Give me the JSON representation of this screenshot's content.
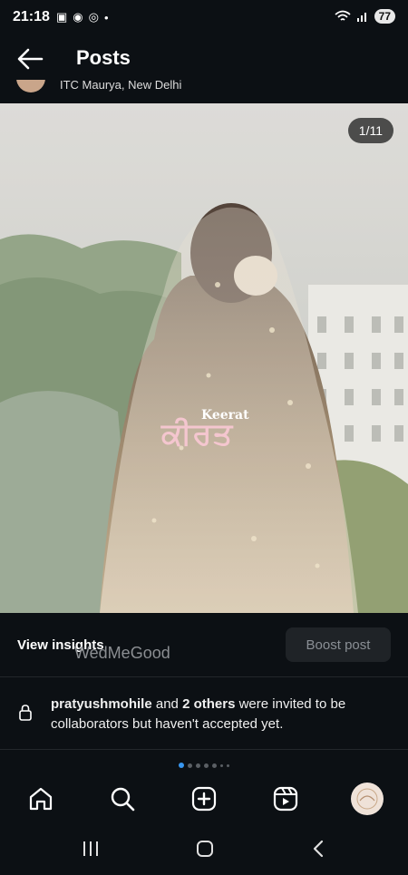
{
  "status": {
    "time": "21:18",
    "battery": "77"
  },
  "header": {
    "title": "Posts"
  },
  "post": {
    "location": "ITC Maurya, New Delhi",
    "counter": "1/11",
    "overlay_en": "Keerat",
    "overlay_pa": "ਕੀਰਤ"
  },
  "insights": {
    "view_label": "View insights",
    "watermark": "WedMeGood",
    "boost_label": "Boost post"
  },
  "collab": {
    "user": "pratyushmohile",
    "connector": " and ",
    "others": "2 others",
    "rest": " were invited to be collaborators but haven't accepted yet."
  },
  "colors": {
    "background": "#0c1014",
    "accent": "#3897f0"
  }
}
